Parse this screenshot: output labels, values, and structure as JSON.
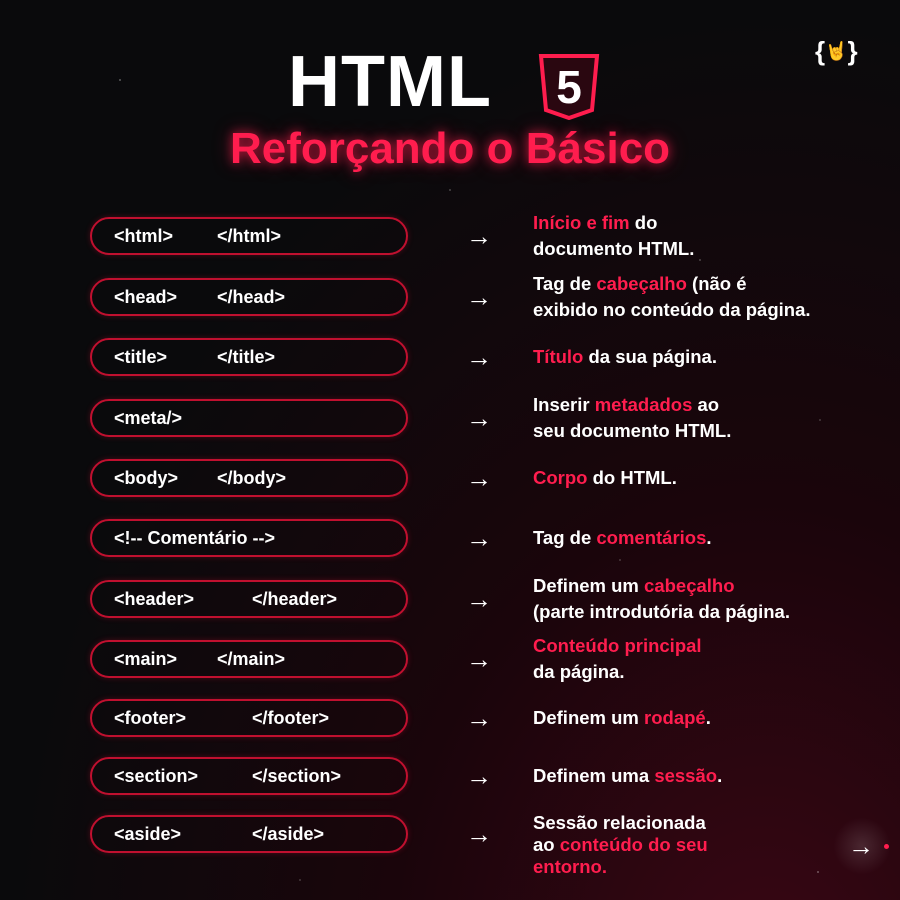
{
  "header": {
    "title": "HTML",
    "badge": "5",
    "subtitle": "Reforçando o Básico",
    "logo": "{🤘}"
  },
  "colors": {
    "accent": "#ff1d4e",
    "border": "#c0102f",
    "background": "#0a0a0c"
  },
  "arrow_glyph": "→",
  "rows": [
    {
      "open": "<html>",
      "close": "</html>",
      "desc": [
        [
          {
            "t": "Início e fim",
            "h": true
          },
          {
            "t": " do"
          }
        ],
        [
          {
            "t": "documento HTML."
          }
        ]
      ]
    },
    {
      "open": "<head>",
      "close": "</head>",
      "desc": [
        [
          {
            "t": "Tag de "
          },
          {
            "t": "cabeçalho",
            "h": true
          },
          {
            "t": " (não é"
          }
        ],
        [
          {
            "t": "exibido no conteúdo da página."
          }
        ]
      ]
    },
    {
      "open": "<title>",
      "close": "</title>",
      "desc": [
        [
          {
            "t": "Título",
            "h": true
          },
          {
            "t": " da sua página."
          }
        ]
      ]
    },
    {
      "open": "<meta/>",
      "close": "",
      "desc": [
        [
          {
            "t": "Inserir "
          },
          {
            "t": "metadados",
            "h": true
          },
          {
            "t": " ao"
          }
        ],
        [
          {
            "t": "seu documento HTML."
          }
        ]
      ]
    },
    {
      "open": "<body>",
      "close": "</body>",
      "desc": [
        [
          {
            "t": "Corpo",
            "h": true
          },
          {
            "t": " do HTML."
          }
        ]
      ]
    },
    {
      "open": "<!-- Comentário -->",
      "close": "",
      "desc": [
        [
          {
            "t": "Tag de "
          },
          {
            "t": "comentários",
            "h": true
          },
          {
            "t": "."
          }
        ]
      ]
    },
    {
      "open": "<header>",
      "close": "</header>",
      "desc": [
        [
          {
            "t": "Definem um "
          },
          {
            "t": "cabeçalho",
            "h": true
          }
        ],
        [
          {
            "t": "(parte introdutória da página."
          }
        ]
      ]
    },
    {
      "open": "<main>",
      "close": "</main>",
      "desc": [
        [
          {
            "t": "Conteúdo principal",
            "h": true
          }
        ],
        [
          {
            "t": "da página."
          }
        ]
      ]
    },
    {
      "open": "<footer>",
      "close": "</footer>",
      "desc": [
        [
          {
            "t": "Definem um "
          },
          {
            "t": "rodapé",
            "h": true
          },
          {
            "t": "."
          }
        ]
      ]
    },
    {
      "open": "<section>",
      "close": "</section>",
      "desc": [
        [
          {
            "t": "Definem uma "
          },
          {
            "t": "sessão",
            "h": true
          },
          {
            "t": "."
          }
        ]
      ]
    },
    {
      "open": "<aside>",
      "close": "</aside>",
      "desc": [
        [
          {
            "t": "Sessão relacionada"
          }
        ],
        [
          {
            "t": "ao "
          },
          {
            "t": "conteúdo do seu",
            "h": true
          }
        ],
        [
          {
            "t": "entorno.",
            "h": true
          }
        ]
      ]
    }
  ],
  "next_button": "→"
}
